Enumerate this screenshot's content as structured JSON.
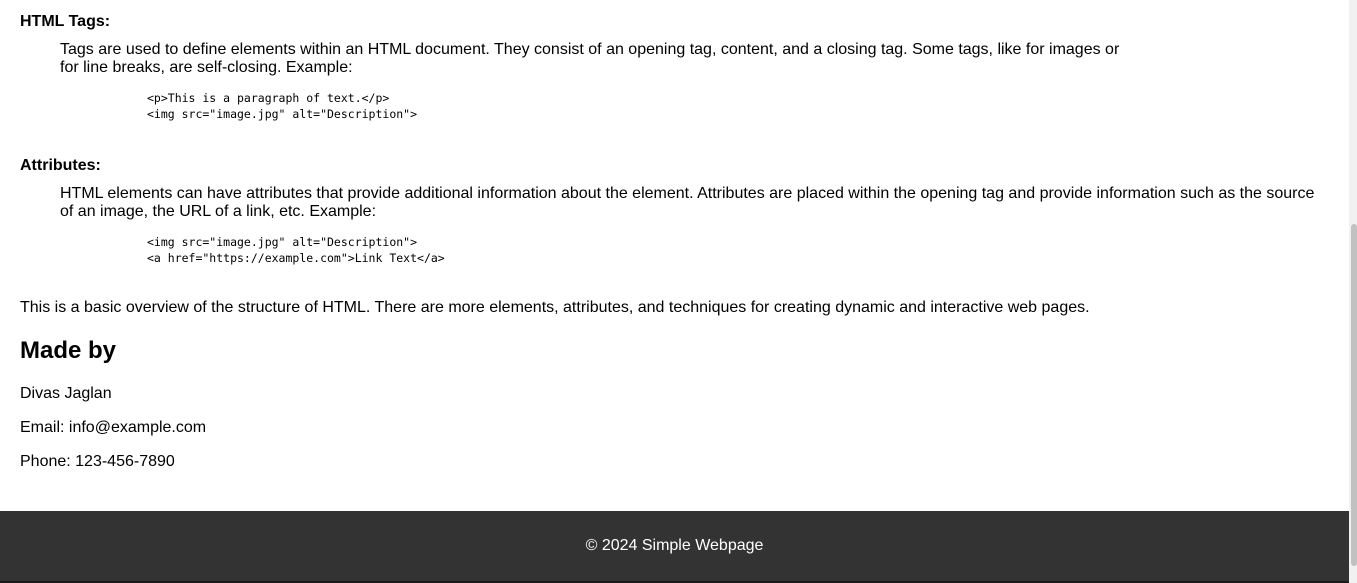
{
  "sections": {
    "tags": {
      "term": "HTML Tags:",
      "desc_line1": "Tags are used to define elements within an HTML document. They consist of an opening tag, content, and a closing tag. Some tags, like  for images or",
      "desc_line2": "for line breaks, are self-closing. Example:",
      "code_line1": "<p>This is a paragraph of text.</p>",
      "code_line2": "<img src=\"image.jpg\" alt=\"Description\">"
    },
    "attributes": {
      "term": "Attributes:",
      "desc_line1": "HTML elements can have attributes that provide additional information about the element. Attributes are placed within the opening tag and provide information such as the source",
      "desc_line2": "of an image, the URL of a link, etc. Example:",
      "code_line1": "<img src=\"image.jpg\" alt=\"Description\">",
      "code_line2": "<a href=\"https://example.com\">Link Text</a>"
    }
  },
  "overview": "This is a basic overview of the structure of HTML. There are more elements, attributes, and techniques for creating dynamic and interactive web pages.",
  "made_by": {
    "heading": "Made by",
    "name": "Divas Jaglan",
    "email": "Email: info@example.com",
    "phone": "Phone: 123-456-7890"
  },
  "footer": {
    "text": "© 2024 Simple Webpage"
  },
  "colors": {
    "footer_bg": "#333333",
    "footer_text": "#ffffff",
    "scrollbar_thumb": "#c1c1c1"
  }
}
